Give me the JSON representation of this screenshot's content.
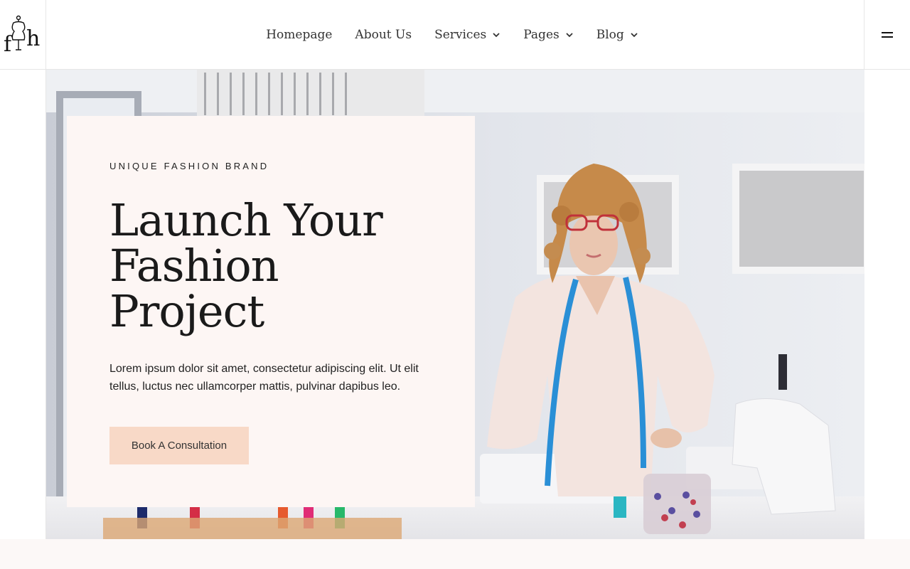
{
  "header": {
    "logo_text": "fh",
    "nav": [
      {
        "label": "Homepage",
        "has_dropdown": false
      },
      {
        "label": "About Us",
        "has_dropdown": false
      },
      {
        "label": "Services",
        "has_dropdown": true
      },
      {
        "label": "Pages",
        "has_dropdown": true
      },
      {
        "label": "Blog",
        "has_dropdown": true
      }
    ],
    "menu_icon": "hamburger-icon"
  },
  "hero": {
    "eyebrow": "UNIQUE FASHION BRAND",
    "headline_lines": [
      "Launch Your",
      "Fashion",
      "Project"
    ],
    "description_lines": [
      "Lorem ipsum dolor sit amet, consectetur adipiscing elit. Ut elit",
      "tellus, luctus nec ullamcorper mattis, pulvinar dapibus leo."
    ],
    "cta_label": "Book A Consultation",
    "image": "woman-tailor-with-measuring-tape-in-studio"
  },
  "colors": {
    "card_bg": "#fdf6f4",
    "cta_bg": "#f8d9c7",
    "measuring_tape": "#2a8fd6"
  }
}
